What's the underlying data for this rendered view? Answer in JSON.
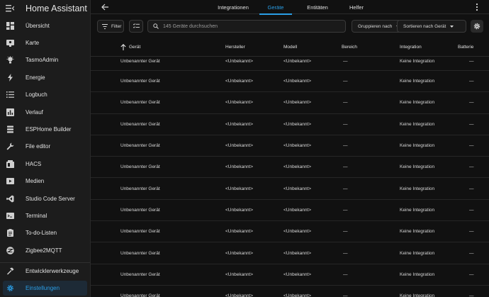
{
  "app": {
    "title": "Home Assistant"
  },
  "sidebar": {
    "items": [
      {
        "label": "Übersicht",
        "icon": "dashboard-icon"
      },
      {
        "label": "Karte",
        "icon": "map-icon"
      },
      {
        "label": "TasmoAdmin",
        "icon": "lightbulb-icon"
      },
      {
        "label": "Energie",
        "icon": "bolt-icon"
      },
      {
        "label": "Logbuch",
        "icon": "list-icon"
      },
      {
        "label": "Verlauf",
        "icon": "chart-icon"
      },
      {
        "label": "ESPHome Builder",
        "icon": "stack-icon"
      },
      {
        "label": "File editor",
        "icon": "wrench-icon"
      },
      {
        "label": "HACS",
        "icon": "hacs-icon"
      },
      {
        "label": "Medien",
        "icon": "media-icon"
      },
      {
        "label": "Studio Code Server",
        "icon": "code-icon"
      },
      {
        "label": "Terminal",
        "icon": "terminal-icon"
      },
      {
        "label": "To-do-Listen",
        "icon": "clipboard-icon"
      },
      {
        "label": "Zigbee2MQTT",
        "icon": "zigbee-icon"
      }
    ],
    "dev_tools": {
      "label": "Entwicklerwerkzeuge",
      "icon": "hammer-icon"
    },
    "settings": {
      "label": "Einstellungen",
      "icon": "cog-icon"
    }
  },
  "tabs": [
    {
      "label": "Integrationen"
    },
    {
      "label": "Geräte"
    },
    {
      "label": "Entitäten"
    },
    {
      "label": "Helfer"
    }
  ],
  "toolbar": {
    "filter_label": "Filter",
    "search_placeholder": "145 Geräte durchsuchen",
    "group_label": "Gruppieren nach",
    "sort_label": "Sortieren nach Gerät"
  },
  "table": {
    "headers": {
      "device": "Gerät",
      "manufacturer": "Hersteller",
      "model": "Modell",
      "area": "Bereich",
      "integration": "Integration",
      "battery": "Batterie"
    },
    "rows": [
      {
        "device": "Unbenannter Gerät",
        "manufacturer": "<Unbekannt>",
        "model": "<Unbekannt>",
        "area": "—",
        "integration": "Keine Integration",
        "battery": "—"
      },
      {
        "device": "Unbenannter Gerät",
        "manufacturer": "<Unbekannt>",
        "model": "<Unbekannt>",
        "area": "—",
        "integration": "Keine Integration",
        "battery": "—"
      },
      {
        "device": "Unbenannter Gerät",
        "manufacturer": "<Unbekannt>",
        "model": "<Unbekannt>",
        "area": "—",
        "integration": "Keine Integration",
        "battery": "—"
      },
      {
        "device": "Unbenannter Gerät",
        "manufacturer": "<Unbekannt>",
        "model": "<Unbekannt>",
        "area": "—",
        "integration": "Keine Integration",
        "battery": "—"
      },
      {
        "device": "Unbenannter Gerät",
        "manufacturer": "<Unbekannt>",
        "model": "<Unbekannt>",
        "area": "—",
        "integration": "Keine Integration",
        "battery": "—"
      },
      {
        "device": "Unbenannter Gerät",
        "manufacturer": "<Unbekannt>",
        "model": "<Unbekannt>",
        "area": "—",
        "integration": "Keine Integration",
        "battery": "—"
      },
      {
        "device": "Unbenannter Gerät",
        "manufacturer": "<Unbekannt>",
        "model": "<Unbekannt>",
        "area": "—",
        "integration": "Keine Integration",
        "battery": "—"
      },
      {
        "device": "Unbenannter Gerät",
        "manufacturer": "<Unbekannt>",
        "model": "<Unbekannt>",
        "area": "—",
        "integration": "Keine Integration",
        "battery": "—"
      },
      {
        "device": "Unbenannter Gerät",
        "manufacturer": "<Unbekannt>",
        "model": "<Unbekannt>",
        "area": "—",
        "integration": "Keine Integration",
        "battery": "—"
      },
      {
        "device": "Unbenannter Gerät",
        "manufacturer": "<Unbekannt>",
        "model": "<Unbekannt>",
        "area": "—",
        "integration": "Keine Integration",
        "battery": "—"
      },
      {
        "device": "Unbenannter Gerät",
        "manufacturer": "<Unbekannt>",
        "model": "<Unbekannt>",
        "area": "—",
        "integration": "Keine Integration",
        "battery": "—"
      },
      {
        "device": "Unbenannter Gerät",
        "manufacturer": "<Unbekannt>",
        "model": "<Unbekannt>",
        "area": "—",
        "integration": "Keine Integration",
        "battery": "—"
      }
    ]
  },
  "colors": {
    "accent": "#2a9ee6",
    "background": "#111111",
    "sidebar": "#1c1c1c"
  }
}
